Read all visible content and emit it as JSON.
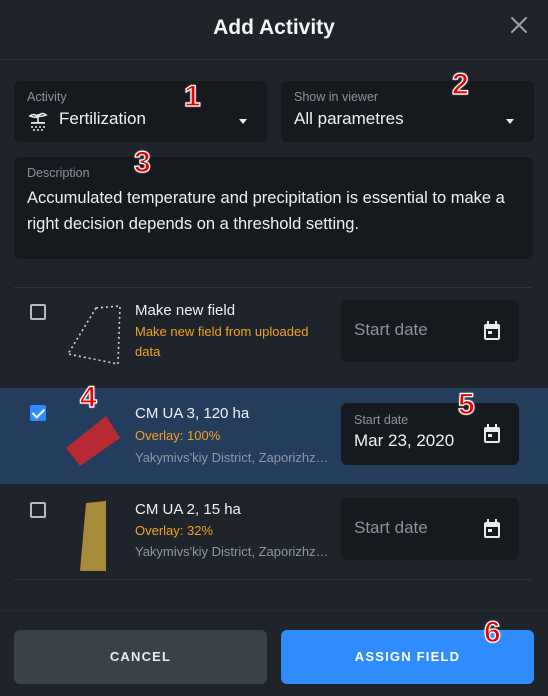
{
  "dialog": {
    "title": "Add Activity"
  },
  "activity": {
    "label": "Activity",
    "value": "Fertilization",
    "icon": "fertilization-icon"
  },
  "viewer": {
    "label": "Show in viewer",
    "value": "All parametres"
  },
  "description": {
    "label": "Description",
    "text": "Accumulated temperature and precipitation is essential to make a right decision depends on a threshold setting."
  },
  "fields": [
    {
      "name": "Make new field",
      "subtitle": "Make new field from uploaded data",
      "subtitle_line1": "Make new field from uploaded",
      "subtitle_line2": "data",
      "checked": false,
      "date_placeholder": "Start date",
      "shape": "dotted-outline"
    },
    {
      "name": "CM UA 3, 120 ha",
      "overlay": "Overlay: 100%",
      "location": "Yakymivs'kiy District, Zaporizhzhia",
      "checked": true,
      "date_label": "Start date",
      "date_value": "Mar 23, 2020",
      "color": "#b52a33"
    },
    {
      "name": "CM UA 2, 15 ha",
      "overlay": "Overlay: 32%",
      "location": "Yakymivs'kiy District, Zaporizhzhia",
      "checked": false,
      "date_placeholder": "Start date",
      "color": "#a88b3a"
    }
  ],
  "buttons": {
    "cancel": "CANCEL",
    "assign": "ASSIGN FIELD"
  },
  "annotations": [
    "1",
    "2",
    "3",
    "4",
    "5",
    "6"
  ],
  "colors": {
    "background": "#1f242b",
    "field": "#161a1f",
    "accent": "#2f8cff",
    "warning": "#f0a21f",
    "selected_row": "#253d5c"
  }
}
